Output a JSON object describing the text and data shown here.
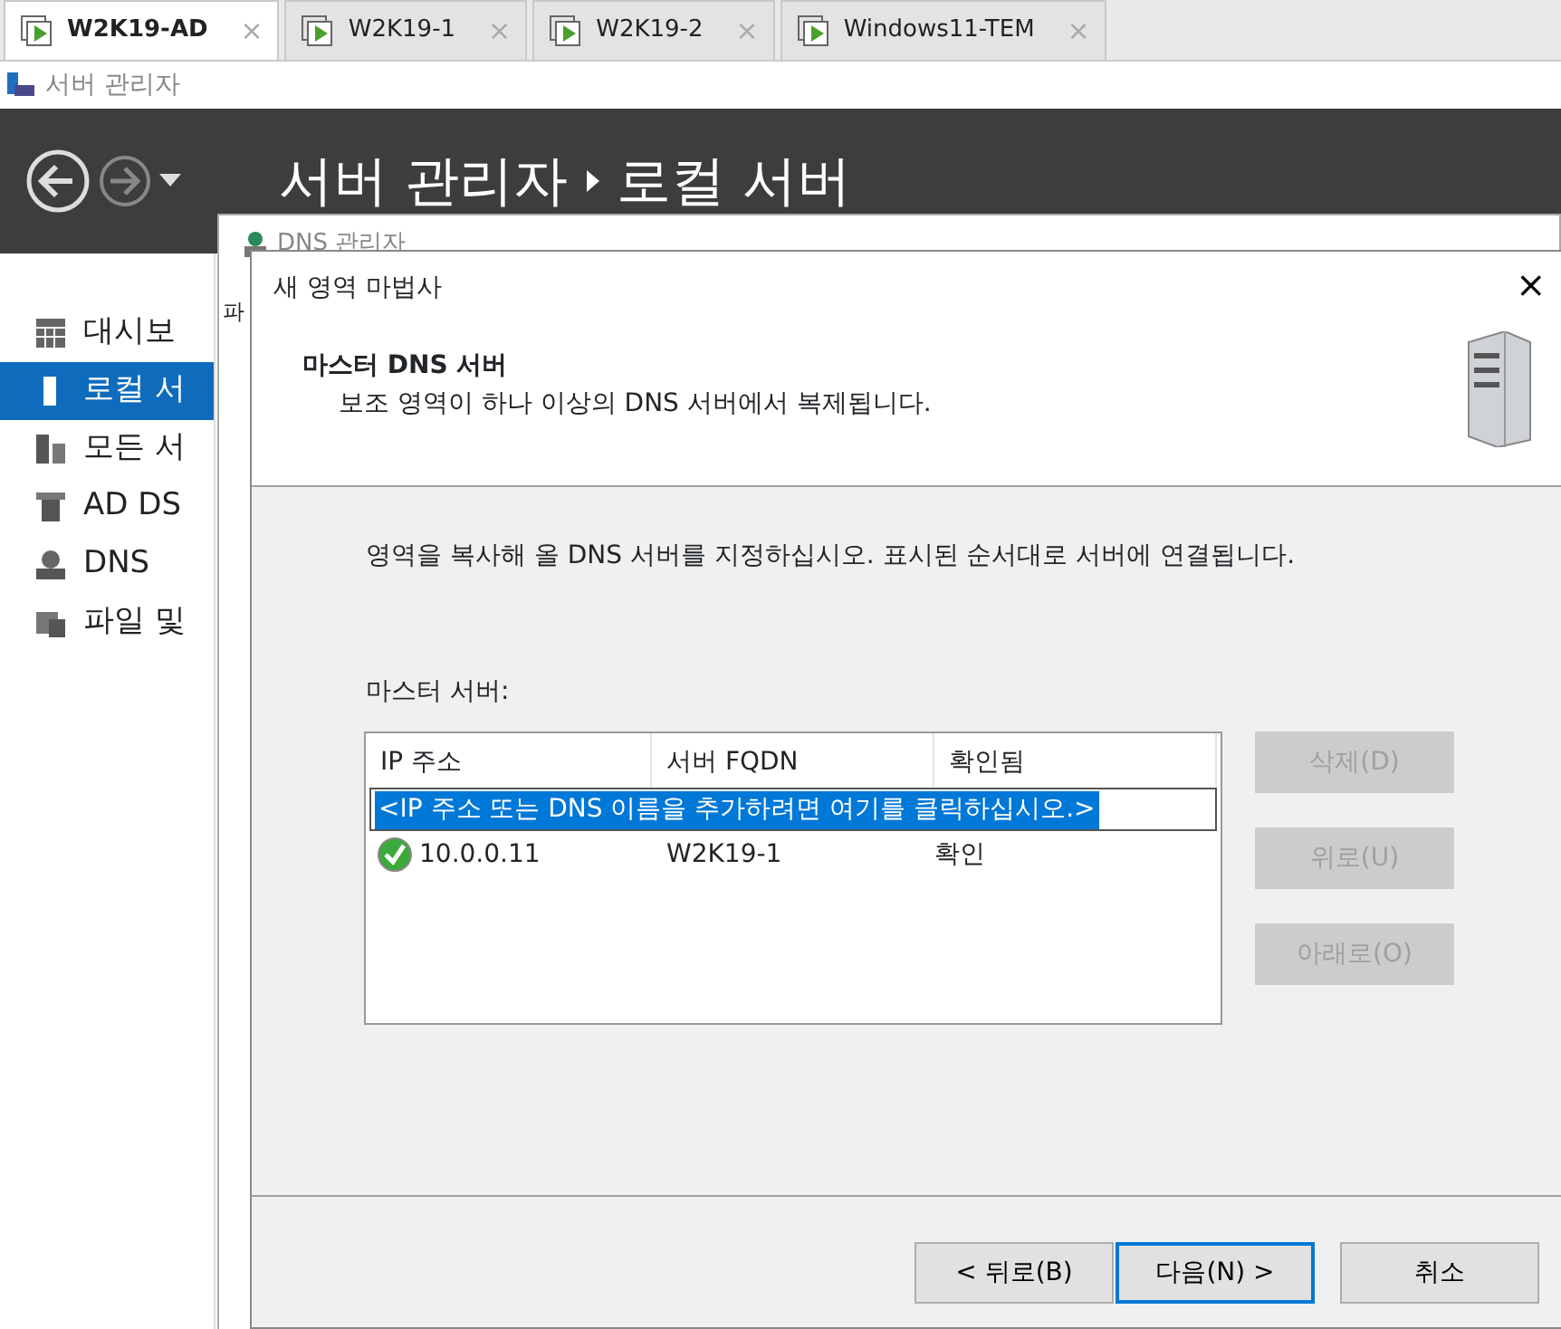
{
  "tabs": [
    {
      "label": "W2K19-AD",
      "close": "×",
      "selected": true
    },
    {
      "label": "W2K19-1",
      "close": "×",
      "selected": false
    },
    {
      "label": "W2K19-2",
      "close": "×",
      "selected": false
    },
    {
      "label": "Windows11-TEM",
      "close": "×",
      "selected": false
    }
  ],
  "app": {
    "title": "서버 관리자"
  },
  "header": {
    "breadcrumb": [
      "서버 관리자",
      "로컬 서버"
    ]
  },
  "sidebar": {
    "items": [
      {
        "label": "대시보",
        "selected": false
      },
      {
        "label": "로컬 서",
        "selected": true
      },
      {
        "label": "모든 서",
        "selected": false
      },
      {
        "label": "AD DS",
        "selected": false
      },
      {
        "label": "DNS",
        "selected": false
      },
      {
        "label": "파일 및",
        "selected": false
      }
    ]
  },
  "background_window": {
    "title": "DNS 관리자",
    "menu": "파"
  },
  "dialog": {
    "title": "새 영역 마법사",
    "close": "×",
    "heading": "마스터 DNS 서버",
    "subheading": "보조 영역이 하나 이상의 DNS 서버에서 복제됩니다.",
    "instruction": "영역을 복사해 올 DNS 서버를 지정하십시오. 표시된 순서대로 서버에 연결됩니다.",
    "list_label": "마스터 서버:",
    "columns": [
      "IP 주소",
      "서버 FQDN",
      "확인됨"
    ],
    "rows": [
      {
        "kind": "prompt",
        "text": "<IP 주소 또는 DNS 이름을 추가하려면 여기를 클릭하십시오.>",
        "selected": true
      },
      {
        "kind": "server",
        "ip": "10.0.0.11",
        "fqdn": "W2K19-1",
        "status": "확인",
        "verified": true,
        "selected": false
      }
    ],
    "side_buttons": [
      {
        "label": "삭제(D)",
        "disabled": true
      },
      {
        "label": "위로(U)",
        "disabled": true
      },
      {
        "label": "아래로(O)",
        "disabled": true
      }
    ],
    "footer_buttons": [
      {
        "label": "< 뒤로(B)",
        "default": false
      },
      {
        "label": "다음(N) >",
        "default": true
      },
      {
        "label": "취소",
        "default": false
      }
    ]
  }
}
